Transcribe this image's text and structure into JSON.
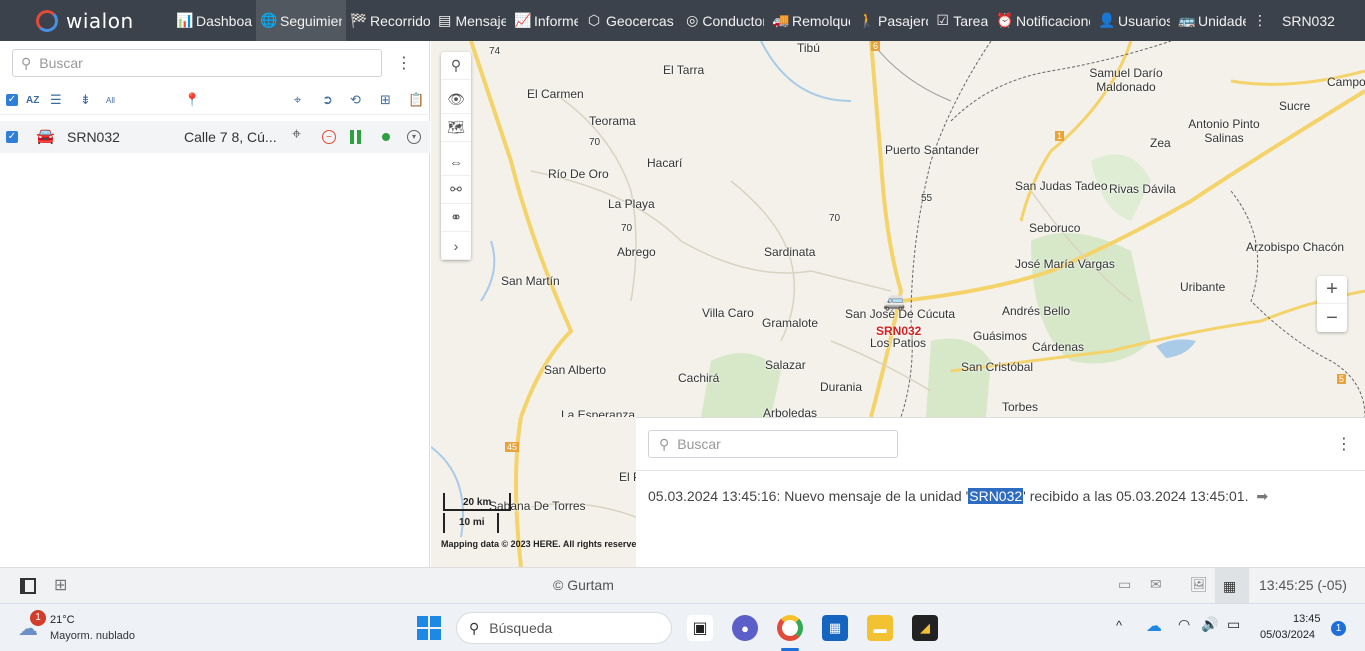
{
  "app": {
    "name": "wialon",
    "user": "SRN032"
  },
  "nav": {
    "items": [
      {
        "icon": "bar-chart-icon",
        "glyph": "📊",
        "label": "Dashboard"
      },
      {
        "icon": "globe-icon",
        "glyph": "🌐",
        "label": "Seguimiento"
      },
      {
        "icon": "checkered-flag-icon",
        "glyph": "🏁",
        "label": "Recorridos"
      },
      {
        "icon": "message-icon",
        "glyph": "▤",
        "label": "Mensajes"
      },
      {
        "icon": "report-icon",
        "glyph": "📈",
        "label": "Informes"
      },
      {
        "icon": "geofence-icon",
        "glyph": "⬡",
        "label": "Geocercas"
      },
      {
        "icon": "steering-wheel-icon",
        "glyph": "◎",
        "label": "Conductores"
      },
      {
        "icon": "trailer-icon",
        "glyph": "🚚",
        "label": "Remolques"
      },
      {
        "icon": "passenger-icon",
        "glyph": "🚶",
        "label": "Pasajeros"
      },
      {
        "icon": "task-icon",
        "glyph": "☑",
        "label": "Tareas"
      },
      {
        "icon": "alarm-clock-icon",
        "glyph": "⏰",
        "label": "Notificaciones"
      },
      {
        "icon": "user-icon",
        "glyph": "👤",
        "label": "Usuarios"
      },
      {
        "icon": "bus-icon",
        "glyph": "🚌",
        "label": "Unidades"
      }
    ],
    "active_index": 1
  },
  "left": {
    "search_placeholder": "Buscar",
    "toolbar": {
      "az": "AZ",
      "all": "All"
    },
    "unit": {
      "name": "SRN032",
      "address": "Calle 7 8, Cú..."
    }
  },
  "map": {
    "labels": [
      {
        "t": "Tibú"
      },
      {
        "t": "El Tarra"
      },
      {
        "t": "El Carmen"
      },
      {
        "t": "Teorama"
      },
      {
        "t": "Hacarí"
      },
      {
        "t": "Río De Oro"
      },
      {
        "t": "La Playa"
      },
      {
        "t": "Abrego"
      },
      {
        "t": "Sardinata"
      },
      {
        "t": "San Martín"
      },
      {
        "t": "Villa Caro"
      },
      {
        "t": "Gramalote"
      },
      {
        "t": "San José De Cúcuta"
      },
      {
        "t": "Los Patios"
      },
      {
        "t": "San Alberto"
      },
      {
        "t": "Cachirá"
      },
      {
        "t": "Salazar"
      },
      {
        "t": "Durania"
      },
      {
        "t": "La Esperanza"
      },
      {
        "t": "Arboledas"
      },
      {
        "t": "Puerto Santander"
      },
      {
        "t": "Samuel Darío Maldonado"
      },
      {
        "t": "Campo"
      },
      {
        "t": "Sucre"
      },
      {
        "t": "Antonio Pinto Salinas"
      },
      {
        "t": "Zea"
      },
      {
        "t": "San Judas Tadeo"
      },
      {
        "t": "Rivas Dávila"
      },
      {
        "t": "Seboruco"
      },
      {
        "t": "Arzobispo Chacón"
      },
      {
        "t": "José María Vargas"
      },
      {
        "t": "Uribante"
      },
      {
        "t": "Andrés Bello"
      },
      {
        "t": "Guásimos"
      },
      {
        "t": "Cárdenas"
      },
      {
        "t": "San Cristóbal"
      },
      {
        "t": "Torbes"
      }
    ],
    "road_numbers": [
      "74",
      "70",
      "70",
      "70",
      "55",
      "6",
      "1",
      "5"
    ],
    "vehicle_label": "SRN032",
    "scale_km": "20 km",
    "scale_mi": "10 mi",
    "low_labels": [
      "Sabana De Torres",
      "El P"
    ],
    "road_45": "45",
    "attribution": "Mapping data © 2023 HERE. All rights reserved"
  },
  "notifications": {
    "search_placeholder": "Buscar",
    "message_before": "05.03.2024 13:45:16: Nuevo mensaje de la unidad '",
    "message_unit": "SRN032",
    "message_after": "' recibido a las 05.03.2024 13:45:01."
  },
  "status": {
    "copyright": "© Gurtam",
    "time": "13:45:25 (-05)"
  },
  "taskbar": {
    "weather_temp": "21°C",
    "weather_desc": "Mayorm. nublado",
    "weather_badge": "1",
    "search_placeholder": "Búsqueda",
    "clock_time": "13:45",
    "clock_date": "05/03/2024",
    "notif_count": "1"
  }
}
